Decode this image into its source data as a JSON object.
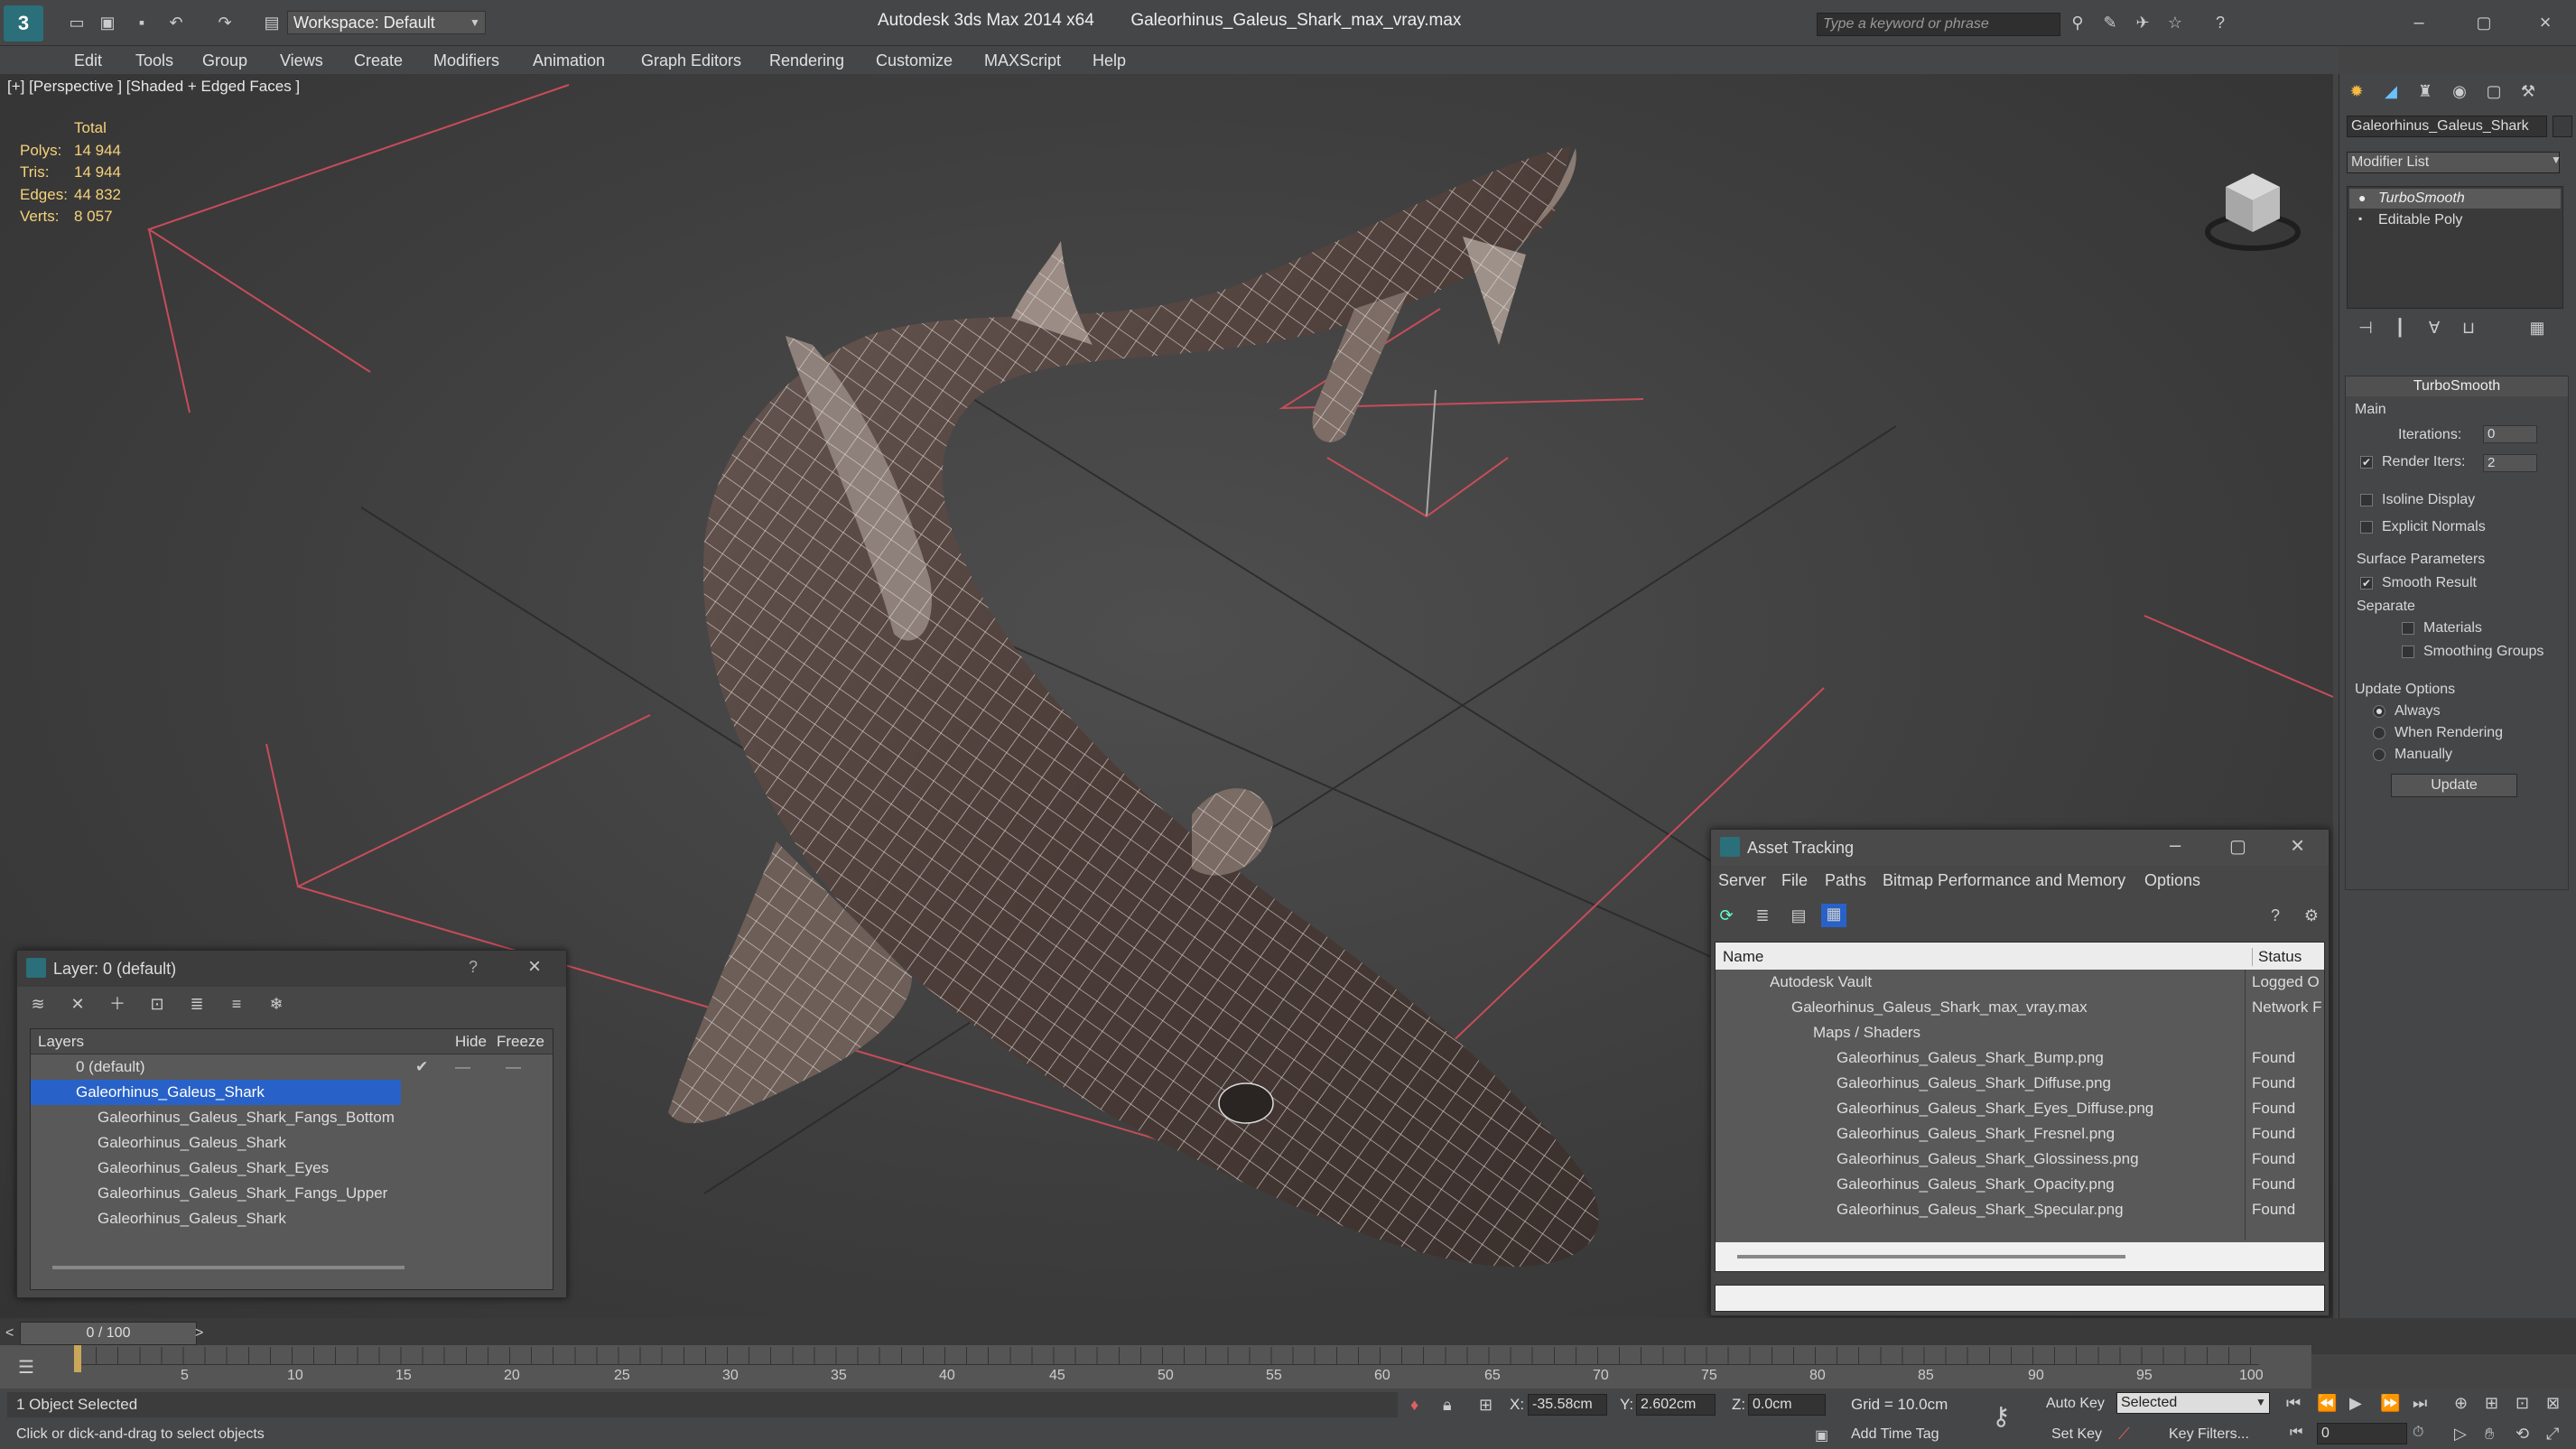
{
  "app": {
    "title": "Autodesk 3ds Max  2014 x64",
    "file": "Galeorhinus_Galeus_Shark_max_vray.max",
    "workspace": "Workspace: Default",
    "search_placeholder": "Type a keyword or phrase"
  },
  "menu": [
    "Edit",
    "Tools",
    "Group",
    "Views",
    "Create",
    "Modifiers",
    "Animation",
    "Graph Editors",
    "Rendering",
    "Customize",
    "MAXScript",
    "Help"
  ],
  "viewport": {
    "label": "[+] [Perspective ] [Shaded + Edged Faces ]",
    "stats": {
      "header": "Total",
      "rows": [
        {
          "label": "Polys:",
          "value": "14 944"
        },
        {
          "label": "Tris:",
          "value": "14 944"
        },
        {
          "label": "Edges:",
          "value": "44 832"
        },
        {
          "label": "Verts:",
          "value": "8 057"
        }
      ]
    }
  },
  "command_panel": {
    "object_name": "Galeorhinus_Galeus_Shark",
    "modifier_list": "Modifier List",
    "stack": [
      "TurboSmooth",
      "Editable Poly"
    ],
    "rollout_title": "TurboSmooth",
    "main_label": "Main",
    "iterations_label": "Iterations:",
    "iterations_value": "0",
    "render_iters_label": "Render Iters:",
    "render_iters_value": "2",
    "isoline": "Isoline Display",
    "explicit": "Explicit Normals",
    "surface_params": "Surface Parameters",
    "smooth_result": "Smooth Result",
    "separate": "Separate",
    "materials": "Materials",
    "smoothing_groups": "Smoothing Groups",
    "update_options": "Update Options",
    "always": "Always",
    "when_rendering": "When Rendering",
    "manually": "Manually",
    "update_btn": "Update"
  },
  "layer_dialog": {
    "title": "Layer: 0 (default)",
    "help": "?",
    "col_layers": "Layers",
    "col_hide": "Hide",
    "col_freeze": "Freeze",
    "rows": [
      "0 (default)",
      "Galeorhinus_Galeus_Shark",
      "Galeorhinus_Galeus_Shark_Fangs_Bottom",
      "Galeorhinus_Galeus_Shark",
      "Galeorhinus_Galeus_Shark_Eyes",
      "Galeorhinus_Galeus_Shark_Fangs_Upper",
      "Galeorhinus_Galeus_Shark"
    ]
  },
  "asset_dialog": {
    "title": "Asset Tracking",
    "menu": [
      "Server",
      "File",
      "Paths",
      "Bitmap Performance and Memory",
      "Options"
    ],
    "col_name": "Name",
    "col_status": "Status",
    "rows": [
      {
        "name": "Autodesk Vault",
        "status": "Logged O"
      },
      {
        "name": "Galeorhinus_Galeus_Shark_max_vray.max",
        "status": "Network F"
      },
      {
        "name": "Maps / Shaders",
        "status": ""
      },
      {
        "name": "Galeorhinus_Galeus_Shark_Bump.png",
        "status": "Found"
      },
      {
        "name": "Galeorhinus_Galeus_Shark_Diffuse.png",
        "status": "Found"
      },
      {
        "name": "Galeorhinus_Galeus_Shark_Eyes_Diffuse.png",
        "status": "Found"
      },
      {
        "name": "Galeorhinus_Galeus_Shark_Fresnel.png",
        "status": "Found"
      },
      {
        "name": "Galeorhinus_Galeus_Shark_Glossiness.png",
        "status": "Found"
      },
      {
        "name": "Galeorhinus_Galeus_Shark_Opacity.png",
        "status": "Found"
      },
      {
        "name": "Galeorhinus_Galeus_Shark_Specular.png",
        "status": "Found"
      }
    ]
  },
  "timeline": {
    "frame": "0 / 100",
    "ticks": [
      "5",
      "10",
      "15",
      "20",
      "25",
      "30",
      "35",
      "40",
      "45",
      "50",
      "55",
      "60",
      "65",
      "70",
      "75",
      "80",
      "85",
      "90",
      "95",
      "100"
    ]
  },
  "status": {
    "selected": "1 Object Selected",
    "hint": "Click or dick-and-drag to select objects",
    "x_label": "X:",
    "x": "-35.58cm",
    "y_label": "Y:",
    "y": "2.602cm",
    "z_label": "Z:",
    "z": "0.0cm",
    "grid": "Grid = 10.0cm",
    "add_time_tag": "Add Time Tag",
    "auto_key": "Auto Key",
    "set_key": "Set Key",
    "selected_dd": "Selected",
    "key_filters": "Key Filters...",
    "frame_field": "0"
  },
  "colors": {
    "selection": "#2862c8",
    "accent": "#f5d27a",
    "grid_red": "#c84c5a"
  }
}
